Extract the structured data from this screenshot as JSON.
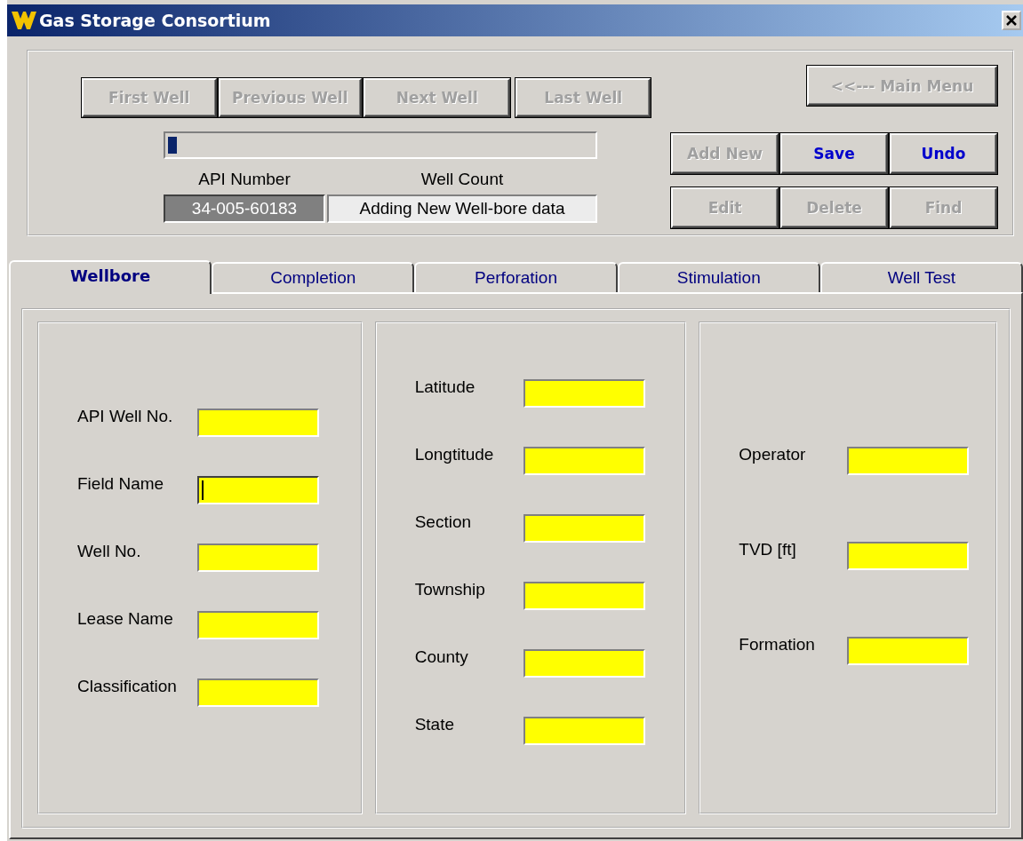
{
  "window": {
    "title": "Gas Storage Consortium"
  },
  "nav_buttons": [
    {
      "label": "First Well",
      "disabled": true
    },
    {
      "label": "Previous Well",
      "disabled": true
    },
    {
      "label": "Next Well",
      "disabled": true
    },
    {
      "label": "Last Well",
      "disabled": true
    }
  ],
  "progress": {
    "level": 0.02
  },
  "api_number": {
    "label": "API Number",
    "value": "34-005-60183"
  },
  "well_count": {
    "label": "Well Count",
    "value": "Adding New Well-bore data"
  },
  "main_menu_button": {
    "label": "<<--- Main Menu",
    "disabled": true
  },
  "action_buttons": [
    {
      "label": "Add New",
      "disabled": true
    },
    {
      "label": "Save",
      "disabled": false
    },
    {
      "label": "Undo",
      "disabled": false
    },
    {
      "label": "Edit",
      "disabled": true
    },
    {
      "label": "Delete",
      "disabled": true
    },
    {
      "label": "Find",
      "disabled": true
    }
  ],
  "tabs": [
    {
      "label": "Wellbore",
      "selected": true
    },
    {
      "label": "Completion",
      "selected": false
    },
    {
      "label": "Perforation",
      "selected": false
    },
    {
      "label": "Stimulation",
      "selected": false
    },
    {
      "label": "Well Test",
      "selected": false
    }
  ],
  "groups": [
    {
      "fields": [
        {
          "label": "API Well No.",
          "focused": false
        },
        {
          "label": "Field Name",
          "focused": true
        },
        {
          "label": "Well No.",
          "focused": false
        },
        {
          "label": "Lease Name",
          "focused": false
        },
        {
          "label": "Classification",
          "focused": false
        }
      ]
    },
    {
      "fields": [
        {
          "label": "Latitude",
          "focused": false
        },
        {
          "label": "Longtitude",
          "focused": false
        },
        {
          "label": "Section",
          "focused": false
        },
        {
          "label": "Township",
          "focused": false
        },
        {
          "label": "County",
          "focused": false
        },
        {
          "label": "State",
          "focused": false
        }
      ]
    },
    {
      "fields": [
        {
          "label": "Operator",
          "focused": false
        },
        {
          "label": "TVD [ft]",
          "focused": false
        },
        {
          "label": "Formation",
          "focused": false
        }
      ]
    }
  ]
}
